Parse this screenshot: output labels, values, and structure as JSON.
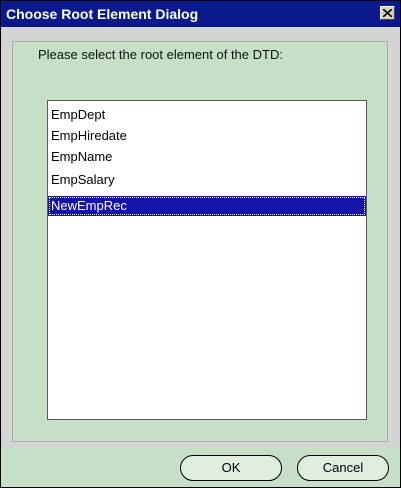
{
  "window": {
    "title": "Choose Root Element Dialog"
  },
  "dialog": {
    "prompt": "Please select the root element of the DTD:",
    "list_items": [
      {
        "label": "EmpDept",
        "selected": false
      },
      {
        "label": "EmpHiredate",
        "selected": false
      },
      {
        "label": "EmpName",
        "selected": false
      },
      {
        "label": "EmpSalary",
        "selected": false
      },
      {
        "label": "NewEmpRec",
        "selected": true
      }
    ]
  },
  "buttons": {
    "ok": "OK",
    "cancel": "Cancel"
  },
  "icons": {
    "close": "close-icon"
  },
  "colors": {
    "titlebar": "#0a1a8c",
    "panel": "#c6dfc6",
    "selection": "#1414a8"
  }
}
